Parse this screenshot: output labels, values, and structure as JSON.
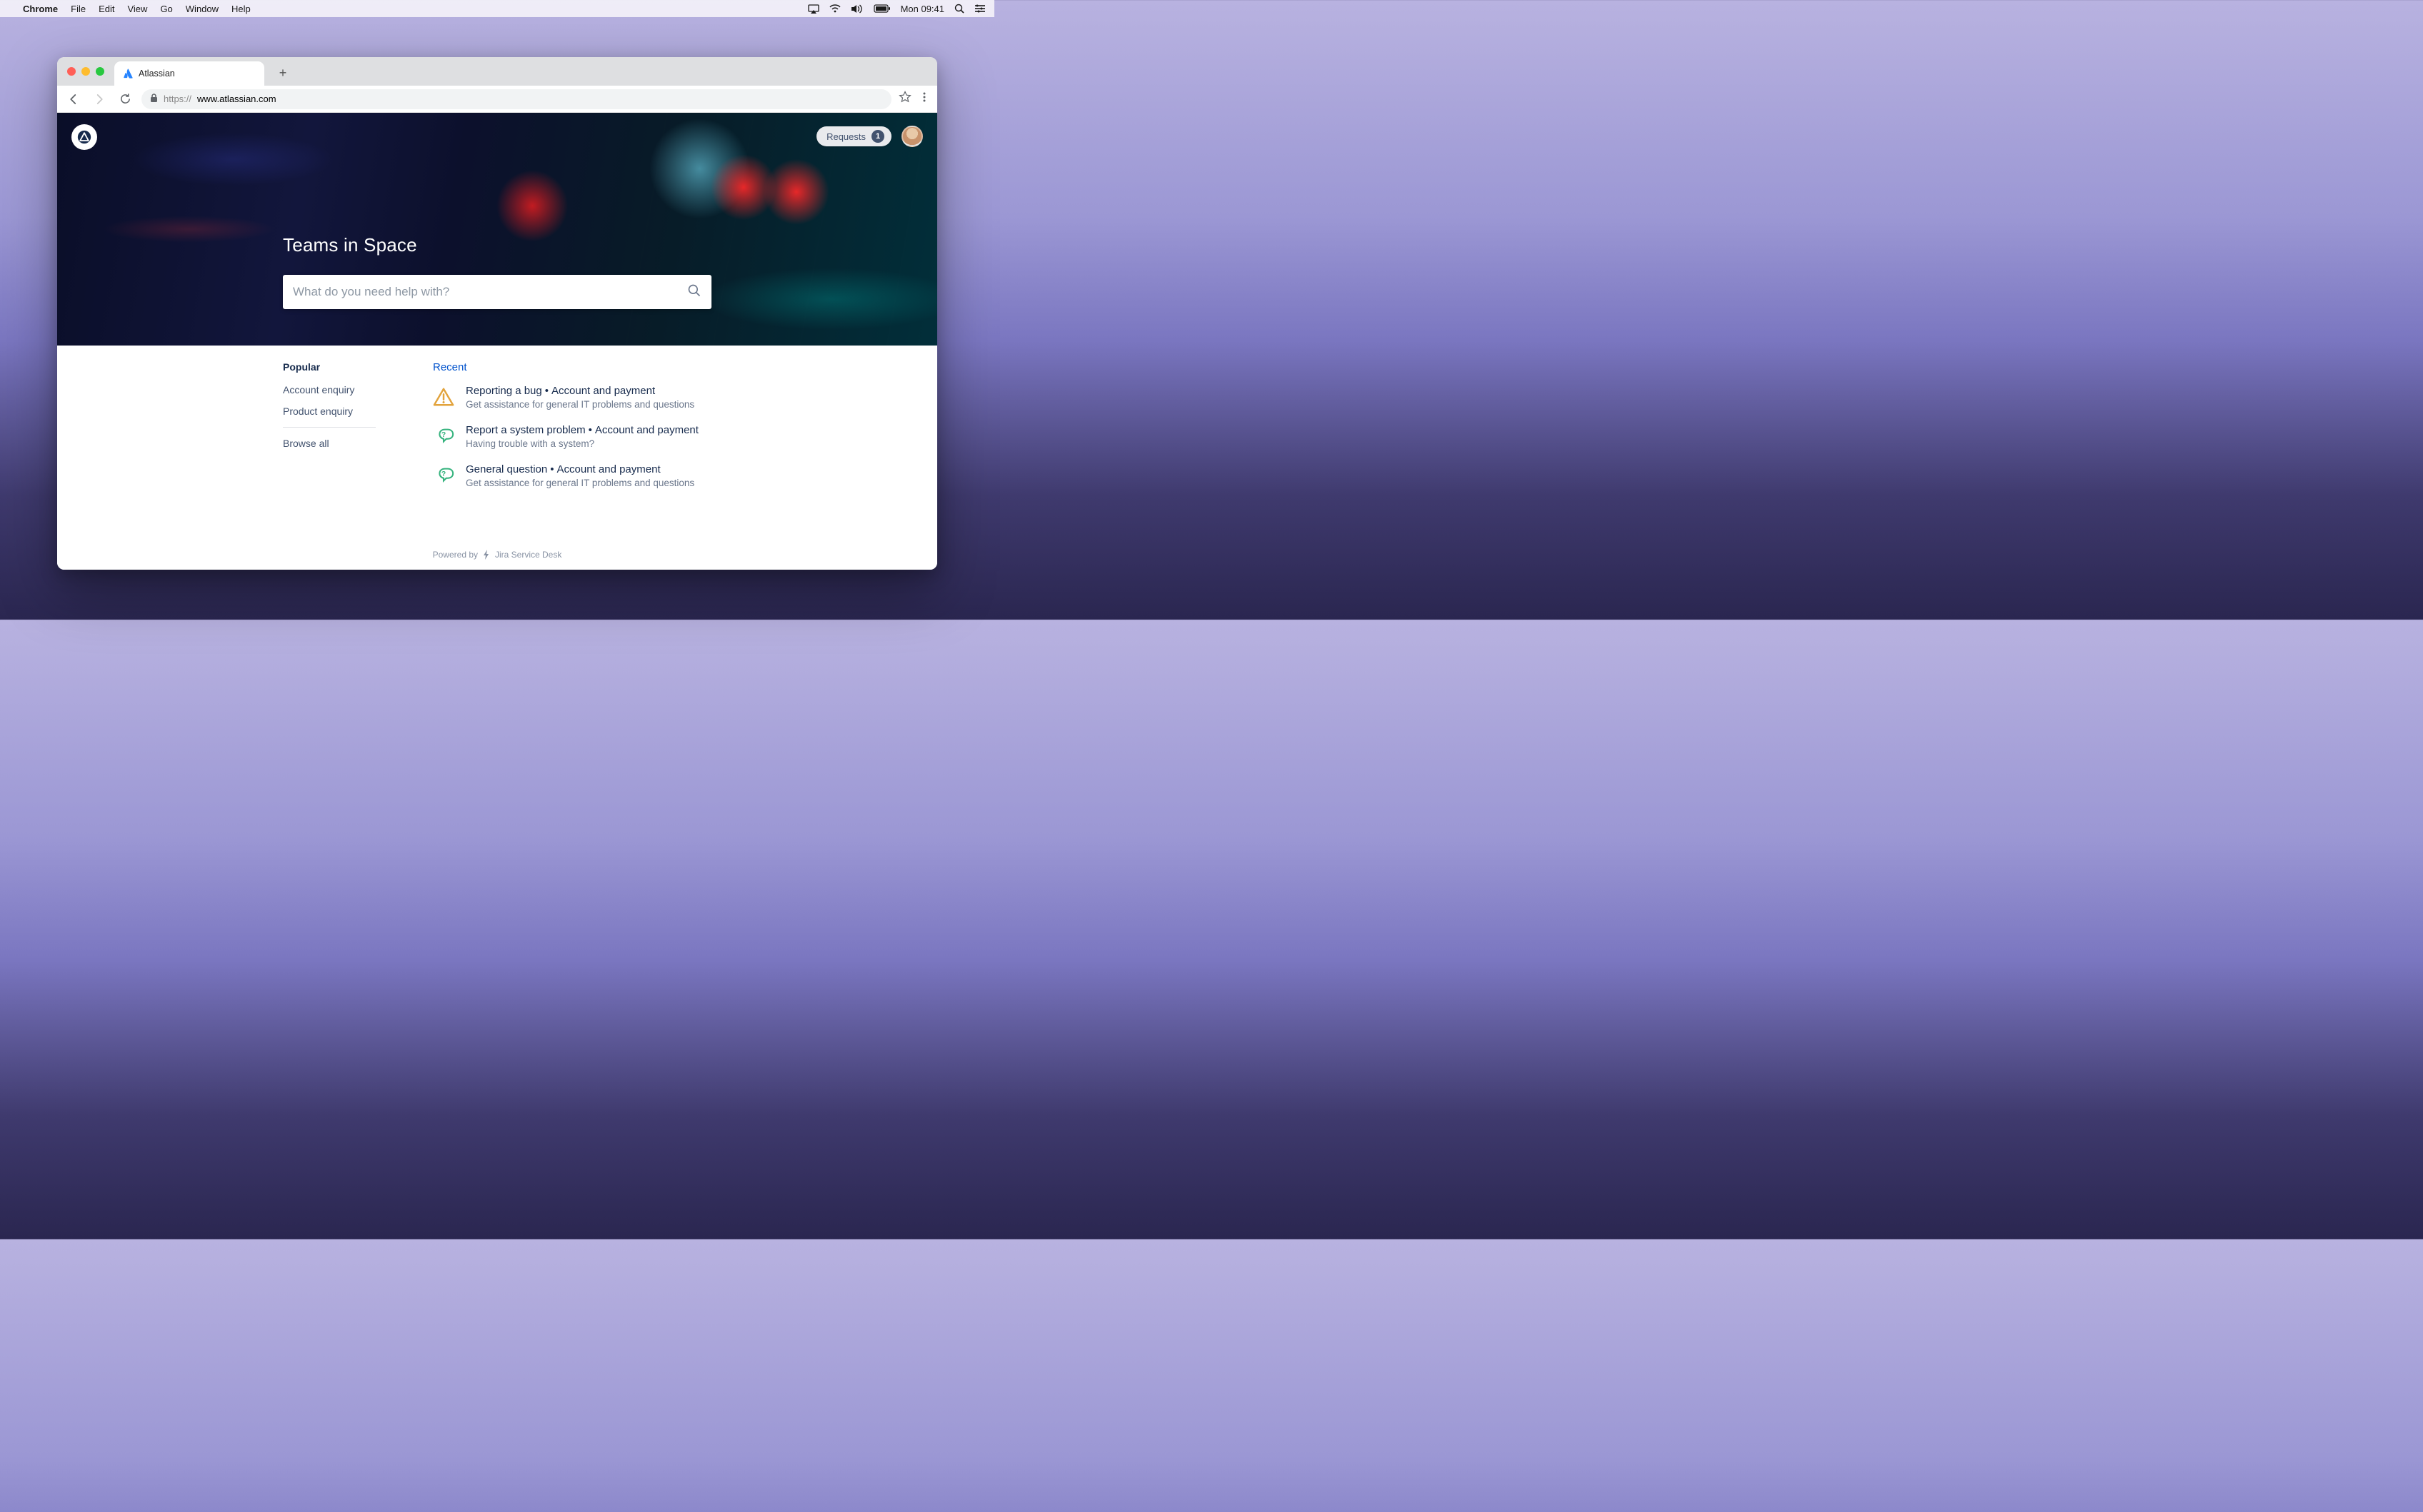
{
  "mac": {
    "app": "Chrome",
    "menus": [
      "File",
      "Edit",
      "View",
      "Go",
      "Window",
      "Help"
    ],
    "clock": "Mon 09:41"
  },
  "browser": {
    "tab_title": "Atlassian",
    "url_protocol": "https://",
    "url_host": "www.atlassian.com"
  },
  "header": {
    "requests_label": "Requests",
    "requests_count": "1"
  },
  "hero": {
    "title": "Teams in Space",
    "search_placeholder": "What do you need help with?"
  },
  "popular": {
    "heading": "Popular",
    "items": [
      "Account enquiry",
      "Product enquiry"
    ],
    "browse_all": "Browse all"
  },
  "recent": {
    "heading": "Recent",
    "items": [
      {
        "title_a": "Reporting a bug",
        "title_b": "Account and payment",
        "desc": "Get assistance for general IT problems and questions",
        "icon": "warning"
      },
      {
        "title_a": "Report a system problem",
        "title_b": "Account and payment",
        "desc": "Having trouble with a system?",
        "icon": "question"
      },
      {
        "title_a": "General question",
        "title_b": "Account and payment",
        "desc": "Get assistance for general IT problems and questions",
        "icon": "question"
      }
    ]
  },
  "footer": {
    "powered_by": "Powered by",
    "product": "Jira Service Desk"
  }
}
